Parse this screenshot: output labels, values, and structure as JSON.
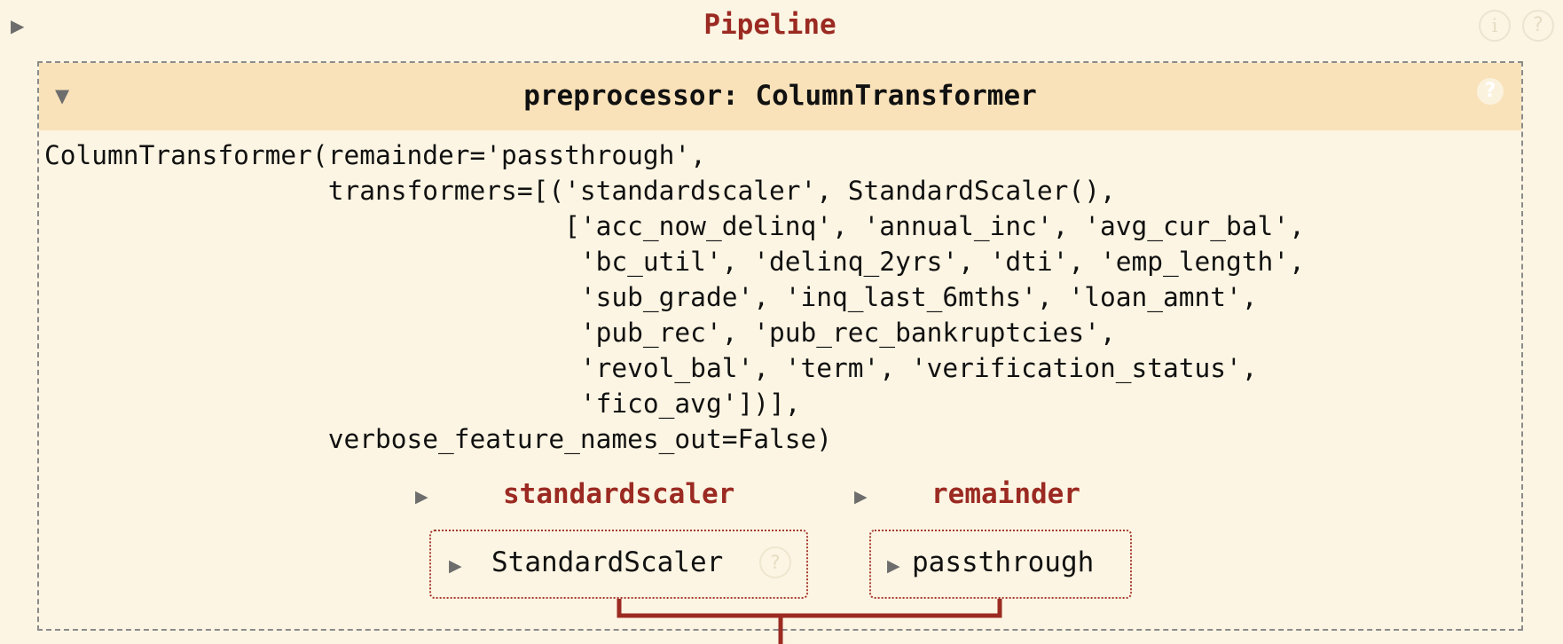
{
  "pipeline": {
    "toggle_glyph": "▶",
    "title": "Pipeline",
    "info_icon": "i",
    "help_icon": "?"
  },
  "column_transformer": {
    "toggle_glyph": "▼",
    "title": "preprocessor: ColumnTransformer",
    "help_icon": "?",
    "repr_lines": [
      "ColumnTransformer(remainder='passthrough',",
      "                  transformers=[('standardscaler', StandardScaler(),",
      "                                 ['acc_now_delinq', 'annual_inc', 'avg_cur_bal',",
      "                                  'bc_util', 'delinq_2yrs', 'dti', 'emp_length',",
      "                                  'sub_grade', 'inq_last_6mths', 'loan_amnt',",
      "                                  'pub_rec', 'pub_rec_bankruptcies',",
      "                                  'revol_bal', 'term', 'verification_status',",
      "                                  'fico_avg'])],",
      "                  verbose_feature_names_out=False)"
    ]
  },
  "branches": {
    "standardscaler": {
      "toggle_glyph": "▶",
      "title": "standardscaler",
      "estimator_toggle_glyph": "▶",
      "estimator_label": "StandardScaler",
      "help_icon": "?"
    },
    "remainder": {
      "toggle_glyph": "▶",
      "title": "remainder",
      "estimator_toggle_glyph": "▶",
      "estimator_label": "passthrough"
    }
  },
  "colors": {
    "background": "#fcf5e3",
    "header_fill": "#f9e2b9",
    "accent": "#9b2a22",
    "text": "#111111"
  }
}
